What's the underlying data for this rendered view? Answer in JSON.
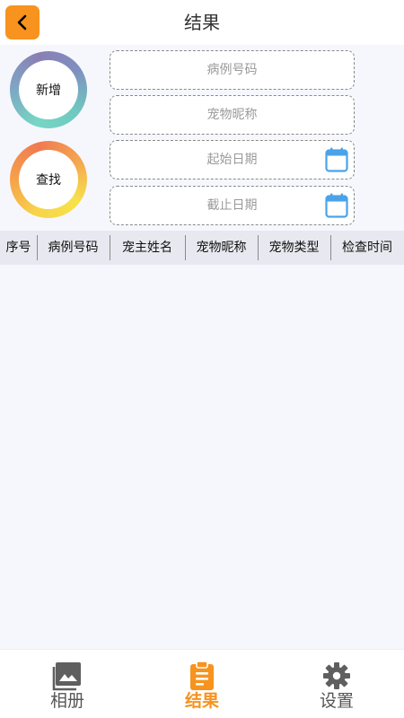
{
  "header": {
    "title": "结果"
  },
  "actions": {
    "add_label": "新增",
    "find_label": "查找"
  },
  "form": {
    "case_number_placeholder": "病例号码",
    "pet_nickname_placeholder": "宠物昵称",
    "start_date_placeholder": "起始日期",
    "end_date_placeholder": "截止日期"
  },
  "table": {
    "columns": [
      "序号",
      "病例号码",
      "宠主姓名",
      "宠物昵称",
      "宠物类型",
      "检查时间"
    ],
    "rows": []
  },
  "nav": {
    "items": [
      {
        "label": "相册",
        "icon": "photo-library-icon",
        "active": false
      },
      {
        "label": "结果",
        "icon": "clipboard-icon",
        "active": true
      },
      {
        "label": "设置",
        "icon": "gear-icon",
        "active": false
      }
    ]
  },
  "colors": {
    "accent": "#f7931e",
    "calendar": "#4aa3e8",
    "nav_inactive": "#555555"
  }
}
